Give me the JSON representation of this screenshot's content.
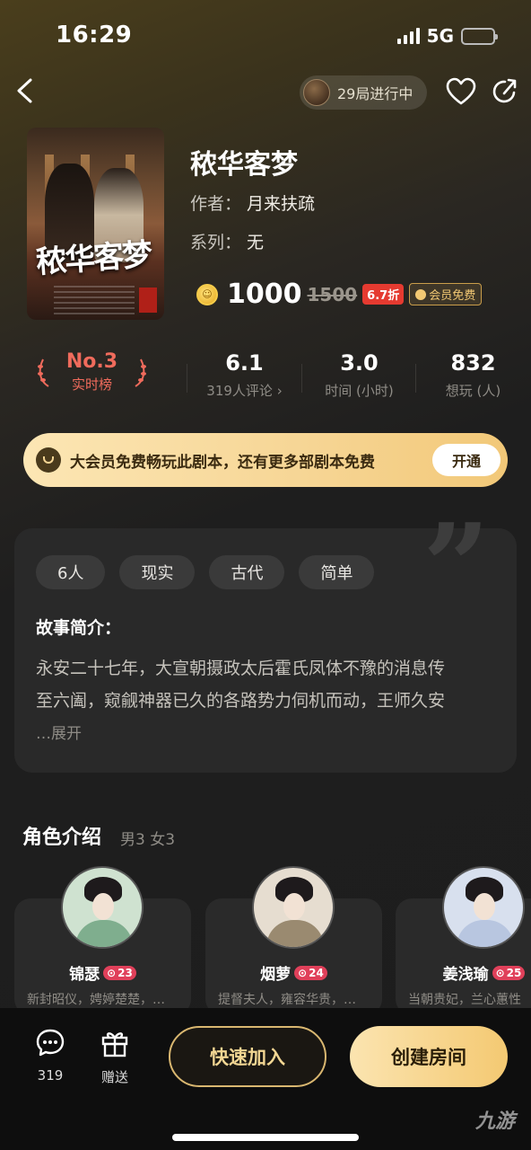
{
  "status": {
    "time": "16:29",
    "network": "5G"
  },
  "nav": {
    "room_status": "29局进行中"
  },
  "script": {
    "cover_title": "秾华客梦",
    "title": "秾华客梦",
    "author_label": "作者：",
    "author": "月来扶疏",
    "series_label": "系列：",
    "series": "无",
    "price": "1000",
    "original_price": "1500",
    "discount": "6.7折",
    "vip_free": "会员免费"
  },
  "stats": {
    "rank": "No.3",
    "rank_label": "实时榜",
    "rating": "6.1",
    "rating_label": "319人评论 ›",
    "time": "3.0",
    "time_label": "时间 (小时)",
    "want": "832",
    "want_label": "想玩 (人)"
  },
  "vip_banner": {
    "text": "大会员免费畅玩此剧本，还有更多部剧本免费",
    "button": "开通"
  },
  "story": {
    "tags": [
      "6人",
      "现实",
      "古代",
      "简单"
    ],
    "heading": "故事简介：",
    "line1": "永安二十七年，大宣朝摄政太后霍氏凤体不豫的消息传",
    "line2": "至六阖，窥觎神器已久的各路势力伺机而动，王师久安",
    "more": "…展开"
  },
  "characters": {
    "heading": "角色介绍",
    "summary": "男3 女3",
    "items": [
      {
        "name": "锦瑟",
        "count": "23",
        "desc": "新封昭仪，娉婷楚楚，…"
      },
      {
        "name": "烟萝",
        "count": "24",
        "desc": "提督夫人，雍容华贵，…"
      },
      {
        "name": "姜浅瑜",
        "count": "25",
        "desc": "当朝贵妃，兰心蕙性"
      }
    ]
  },
  "bottom": {
    "comments": "319",
    "gift": "赠送",
    "quick_join": "快速加入",
    "create_room": "创建房间"
  },
  "watermark": "九游",
  "colors": {
    "accent_gold": "#f2c873",
    "rank_red": "#f06b5c",
    "discount_red": "#e53a30"
  }
}
